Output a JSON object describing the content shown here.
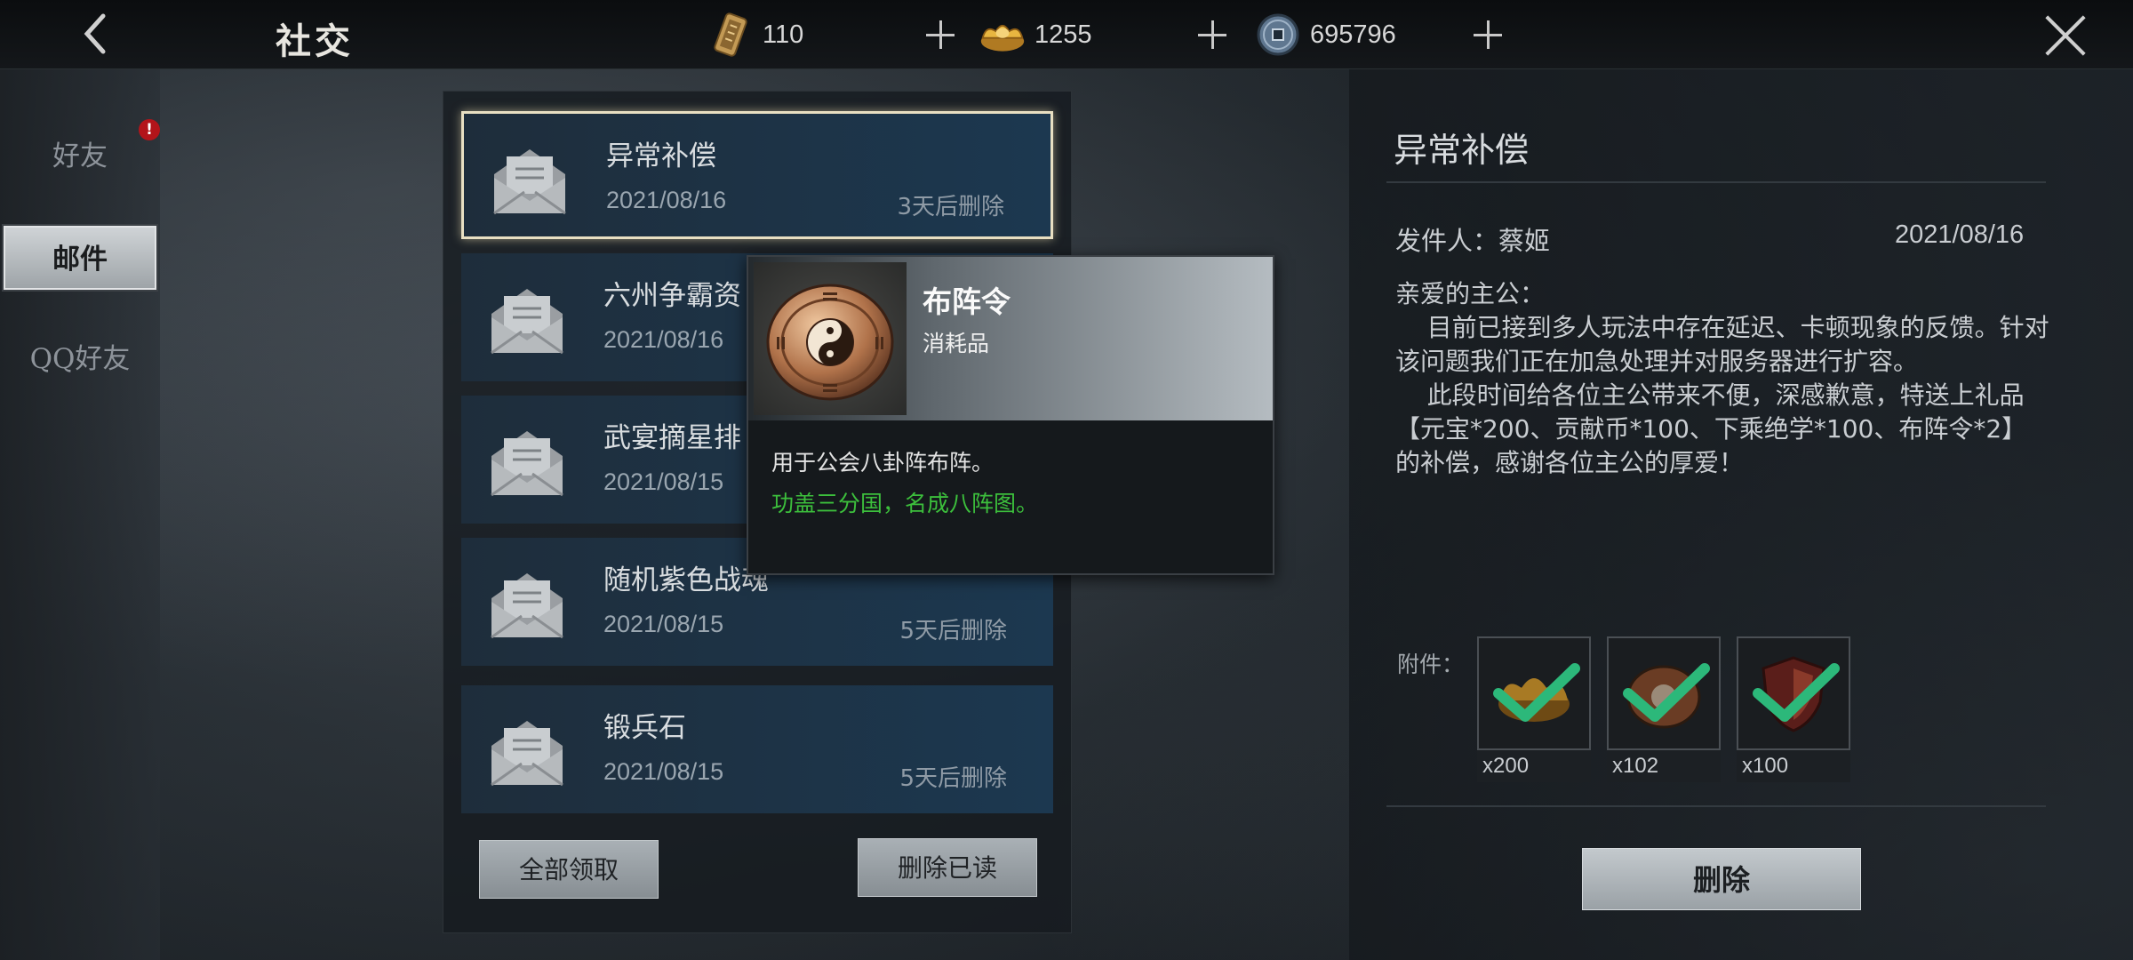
{
  "header": {
    "title": "社交",
    "currencies": [
      {
        "icon": "token-icon",
        "value": "110"
      },
      {
        "icon": "gold-ingot-icon",
        "value": "1255"
      },
      {
        "icon": "copper-coin-icon",
        "value": "695796"
      }
    ]
  },
  "sidebar": {
    "tabs": [
      {
        "label": "好友"
      },
      {
        "label": "邮件"
      },
      {
        "label": "QQ好友"
      }
    ],
    "badge": "!"
  },
  "mail_list": {
    "items": [
      {
        "subject": "异常补偿",
        "date": "2021/08/16",
        "expires": "3天后删除"
      },
      {
        "subject": "六州争霸资",
        "date": "2021/08/16",
        "expires": ""
      },
      {
        "subject": "武宴摘星排",
        "date": "2021/08/15",
        "expires": ""
      },
      {
        "subject": "随机紫色战魂",
        "date": "2021/08/15",
        "expires": "5天后删除"
      },
      {
        "subject": "锻兵石",
        "date": "2021/08/15",
        "expires": "5天后删除"
      }
    ],
    "claim_all_label": "全部领取",
    "delete_read_label": "删除已读"
  },
  "tooltip": {
    "name": "布阵令",
    "type": "消耗品",
    "description": "用于公会八卦阵布阵。",
    "flavor": "功盖三分国，名成八阵图。"
  },
  "detail": {
    "title": "异常补偿",
    "sender": "发件人：蔡姬",
    "date": "2021/08/16",
    "body": [
      "亲爱的主公：",
      "    目前已接到多人玩法中存在延迟、卡顿现象的反馈。针对该问题我们正在加急处理并对服务器进行扩容。",
      "    此段时间给各位主公带来不便，深感歉意，特送上礼品【元宝*200、贡献币*100、下乘绝学*100、布阵令*2】的补偿，感谢各位主公的厚爱！"
    ],
    "attachments_label": "附件：",
    "attachments": [
      {
        "icon": "gold-ingot-icon",
        "qty": "x200"
      },
      {
        "icon": "bagua-token-icon",
        "qty": "x102"
      },
      {
        "icon": "shield-icon",
        "qty": "x100"
      }
    ],
    "delete_label": "删除"
  },
  "colors": {
    "accent_green": "#3cbf3c",
    "badge_red": "#b3141a",
    "mail_blue": "#1c3850"
  }
}
